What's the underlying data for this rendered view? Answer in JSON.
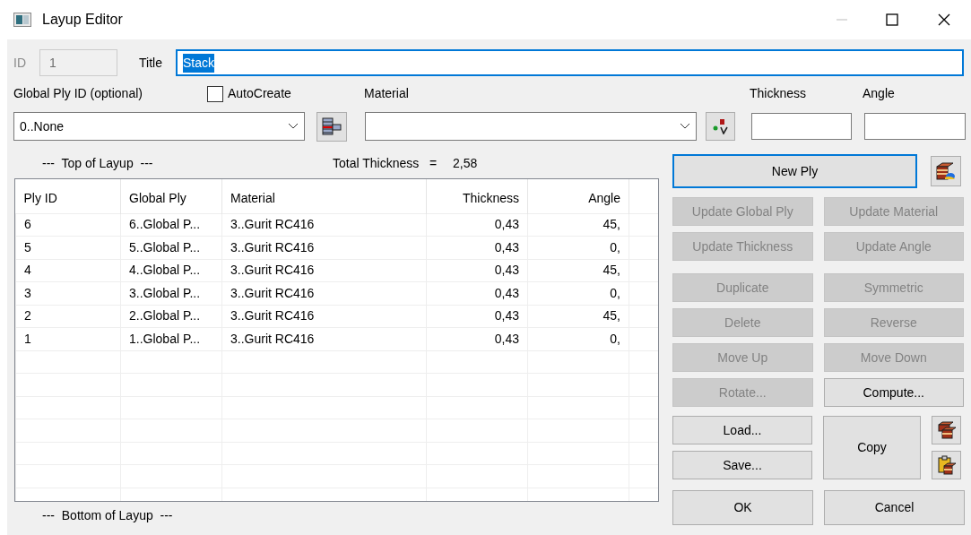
{
  "window": {
    "title": "Layup Editor"
  },
  "id_field": {
    "label": "ID",
    "value": "1",
    "disabled": true
  },
  "title_field": {
    "label": "Title",
    "value": "Stack",
    "text_selected": true
  },
  "global_ply": {
    "label": "Global Ply ID (optional)",
    "value": "0..None"
  },
  "autocreate": {
    "label": "AutoCreate",
    "checked": false
  },
  "material": {
    "label": "Material"
  },
  "thickness": {
    "label": "Thickness"
  },
  "angle": {
    "label": "Angle"
  },
  "top_label": "---  Top of Layup  ---",
  "total_thickness": {
    "label": "Total Thickness   =",
    "value": "2,58"
  },
  "table": {
    "columns": [
      "Ply ID",
      "Global Ply",
      "Material",
      "Thickness",
      "Angle"
    ],
    "rows": [
      {
        "ply_id": "6",
        "global_ply": "6..Global P...",
        "material": "3..Gurit RC416",
        "thickness": "0,43",
        "angle": "45,"
      },
      {
        "ply_id": "5",
        "global_ply": "5..Global P...",
        "material": "3..Gurit RC416",
        "thickness": "0,43",
        "angle": "0,"
      },
      {
        "ply_id": "4",
        "global_ply": "4..Global P...",
        "material": "3..Gurit RC416",
        "thickness": "0,43",
        "angle": "45,"
      },
      {
        "ply_id": "3",
        "global_ply": "3..Global P...",
        "material": "3..Gurit RC416",
        "thickness": "0,43",
        "angle": "0,"
      },
      {
        "ply_id": "2",
        "global_ply": "2..Global P...",
        "material": "3..Gurit RC416",
        "thickness": "0,43",
        "angle": "45,"
      },
      {
        "ply_id": "1",
        "global_ply": "1..Global P...",
        "material": "3..Gurit RC416",
        "thickness": "0,43",
        "angle": "0,"
      }
    ]
  },
  "bottom_label": "---  Bottom of Layup  ---",
  "new_ply_button": {
    "label": "New Ply",
    "focused": true
  },
  "action_buttons": [
    {
      "label": "Update Global Ply",
      "disabled": true
    },
    {
      "label": "Update Material",
      "disabled": true
    },
    {
      "label": "Update Thickness",
      "disabled": true
    },
    {
      "label": "Update Angle",
      "disabled": true
    },
    {
      "label": "Duplicate",
      "disabled": true
    },
    {
      "label": "Symmetric",
      "disabled": true
    },
    {
      "label": "Delete",
      "disabled": true
    },
    {
      "label": "Reverse",
      "disabled": true
    },
    {
      "label": "Move Up",
      "disabled": true
    },
    {
      "label": "Move Down",
      "disabled": true
    },
    {
      "label": "Rotate...",
      "disabled": true
    },
    {
      "label": "Compute...",
      "disabled": false
    }
  ],
  "file_buttons": [
    {
      "label": "Load..."
    },
    {
      "label": "Save..."
    }
  ],
  "copy_button": {
    "label": "Copy"
  },
  "dialog_buttons": [
    {
      "label": "OK"
    },
    {
      "label": "Cancel"
    }
  ]
}
